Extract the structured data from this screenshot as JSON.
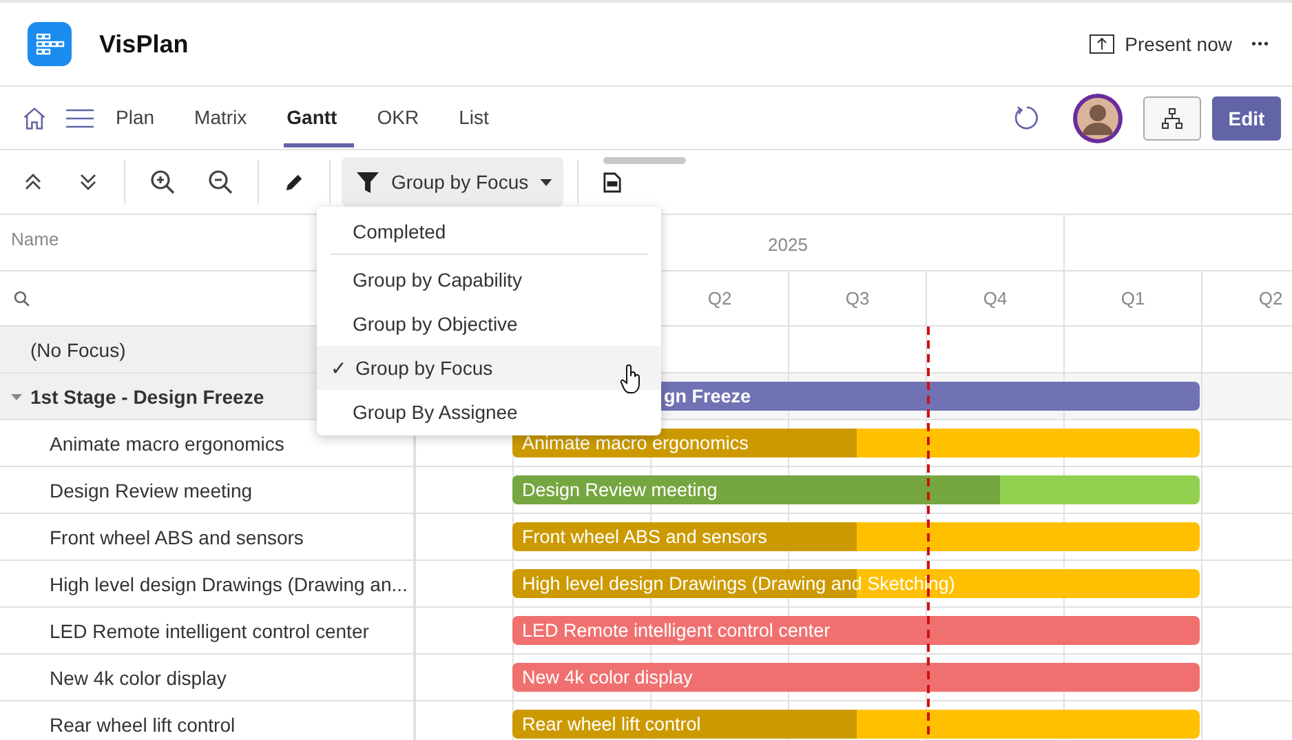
{
  "app": {
    "name": "VisPlan",
    "present_label": "Present now",
    "more_label": "•••"
  },
  "nav": {
    "tabs": [
      {
        "label": "Plan",
        "selected": false
      },
      {
        "label": "Matrix",
        "selected": false
      },
      {
        "label": "Gantt",
        "selected": true
      },
      {
        "label": "OKR",
        "selected": false
      },
      {
        "label": "List",
        "selected": false
      }
    ],
    "edit_label": "Edit"
  },
  "toolbar": {
    "group_button": "Group by Focus"
  },
  "group_menu": {
    "completed": "Completed",
    "options": [
      {
        "label": "Group by Capability",
        "selected": false
      },
      {
        "label": "Group by Objective",
        "selected": false
      },
      {
        "label": "Group by Focus",
        "selected": true,
        "check": "✓"
      },
      {
        "label": "Group By Assignee",
        "selected": false
      }
    ]
  },
  "grid": {
    "name_header": "Name",
    "year": "2025",
    "quarters": [
      "Q2",
      "Q3",
      "Q4",
      "Q1",
      "Q2"
    ]
  },
  "rows": [
    {
      "kind": "group",
      "name": "(No Focus)"
    },
    {
      "kind": "group",
      "name": "1st Stage - Design Freeze",
      "expanded": true,
      "bar": {
        "label": "gn Freeze",
        "color": "#7072b3"
      }
    },
    {
      "kind": "task",
      "name": "Animate macro ergonomics",
      "bar": {
        "label": "Animate macro ergonomics",
        "color": "#ffc000",
        "level": 0.5
      }
    },
    {
      "kind": "task",
      "name": "Design Review meeting",
      "bar": {
        "label": "Design Review meeting",
        "color": "#92d050",
        "level": 0.71
      }
    },
    {
      "kind": "task",
      "name": "Front wheel ABS and sensors",
      "bar": {
        "label": "Front wheel ABS and sensors",
        "color": "#ffc000",
        "level": 0.5
      }
    },
    {
      "kind": "task",
      "name": "High level design Drawings (Drawing an...",
      "bar": {
        "label": "High level design Drawings (Drawing and Sketching)",
        "color": "#ffc000",
        "level": 0.5
      }
    },
    {
      "kind": "task",
      "name": "LED Remote intelligent control center",
      "bar": {
        "label": "LED Remote intelligent control center",
        "color": "#f07070"
      }
    },
    {
      "kind": "task",
      "name": "New 4k color display",
      "bar": {
        "label": "New 4k color display",
        "color": "#f07070"
      }
    },
    {
      "kind": "task",
      "name": "Rear wheel lift control",
      "bar": {
        "label": "Rear wheel lift control",
        "color": "#ffc000",
        "level": 0.5
      }
    }
  ]
}
